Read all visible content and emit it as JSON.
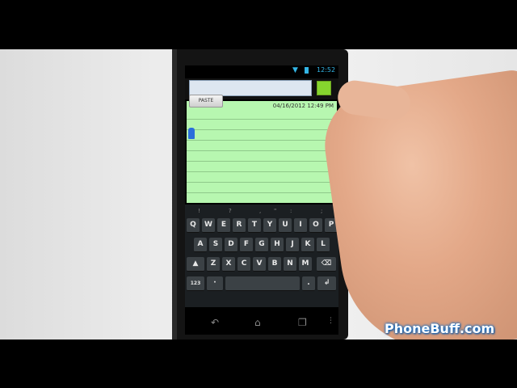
{
  "status_bar": {
    "time": "12:52",
    "wifi_icon": "wifi-icon",
    "battery_icon": "battery-icon"
  },
  "note_editor": {
    "paste_label": "PASTE",
    "date": "04/16/2012 12:49 PM",
    "note_color": "#b7f7b0",
    "color_button": "#86d52e"
  },
  "keyboard": {
    "symbols": [
      "!",
      "?",
      ",",
      "\"",
      ":",
      ";"
    ],
    "row1": [
      "Q",
      "W",
      "E",
      "R",
      "T",
      "Y",
      "U",
      "I",
      "O",
      "P"
    ],
    "row2": [
      "A",
      "S",
      "D",
      "F",
      "G",
      "H",
      "J",
      "K",
      "L"
    ],
    "row3": [
      "Z",
      "X",
      "C",
      "V",
      "B",
      "N",
      "M"
    ],
    "shift_icon": "shift-icon",
    "delete_icon": "backspace-icon",
    "numbers_label": "123",
    "period_label": ".",
    "enter_icon": "enter-icon"
  },
  "navbar": {
    "back_icon": "back-icon",
    "home_icon": "home-icon",
    "recents_icon": "recents-icon"
  },
  "watermark": "PhoneBuff.com"
}
